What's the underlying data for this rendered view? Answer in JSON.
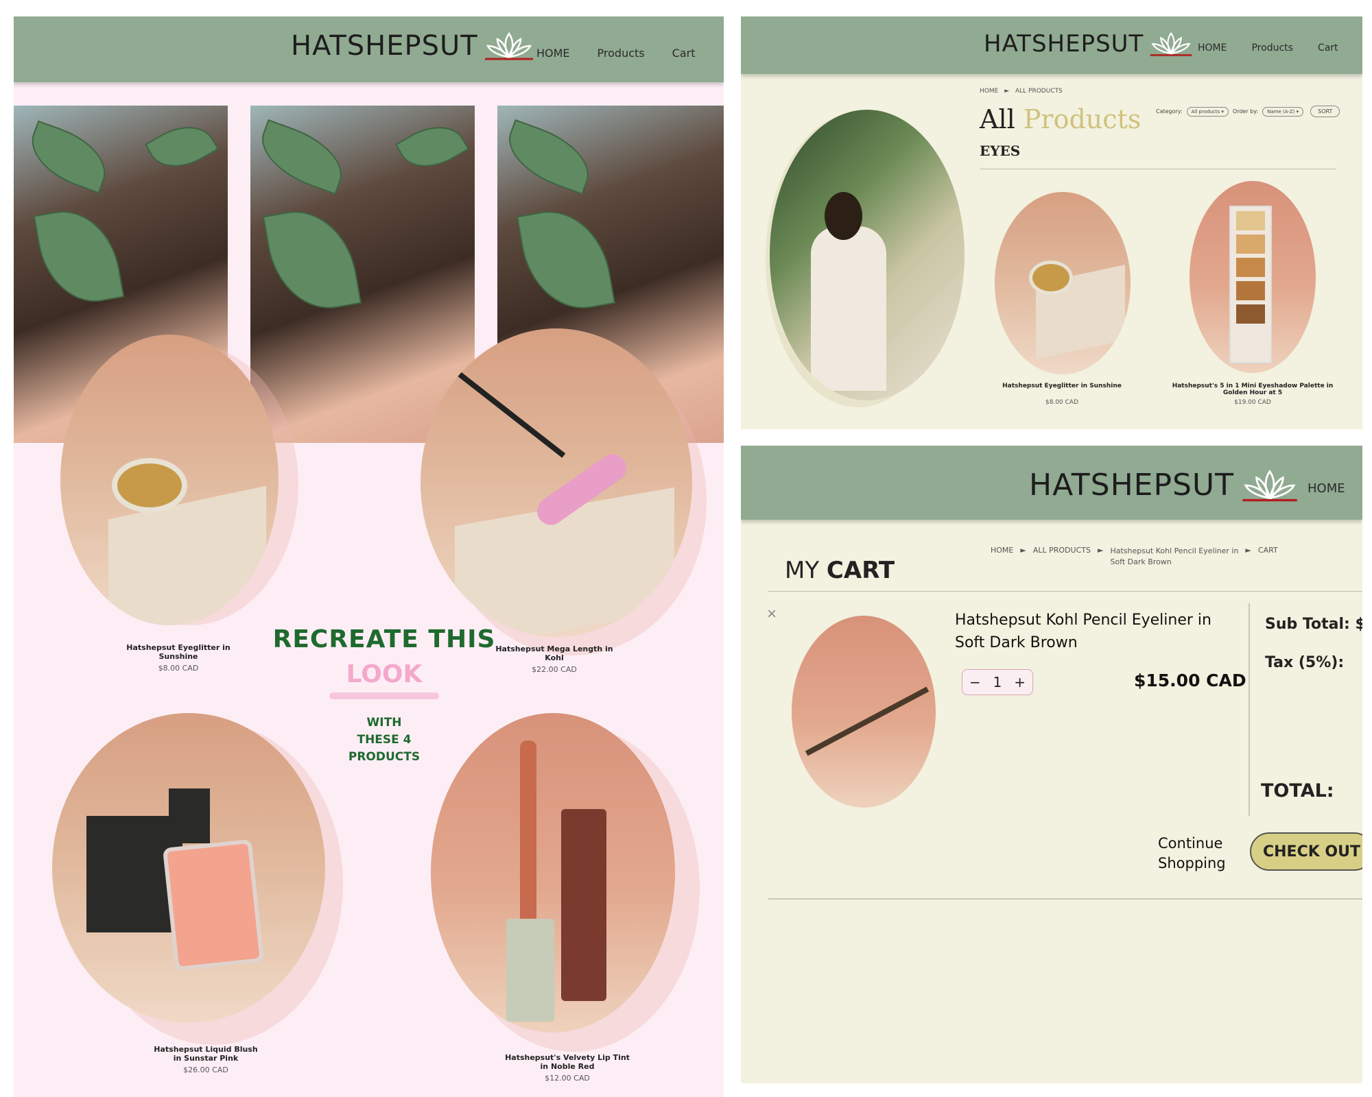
{
  "brand": {
    "name": "HATSHEPSUT"
  },
  "colors": {
    "header": "#91aa92",
    "pink_bg": "#fdeef5",
    "cream_bg": "#f3f1df",
    "accent_green": "#1f6a2e",
    "accent_pink": "#f4a8cc",
    "gold_button": "#d8cf86"
  },
  "landing": {
    "nav": [
      "HOME",
      "Products",
      "Cart"
    ],
    "headline_line1": "RECREATE THIS",
    "headline_line2": "LOOK",
    "subline": [
      "WITH",
      "THESE 4",
      "PRODUCTS"
    ],
    "products": [
      {
        "name": "Hatshepsut Eyeglitter in Sunshine",
        "price": "$8.00 CAD"
      },
      {
        "name": "Hatshepsut Mega Length in Kohl",
        "price": "$22.00 CAD"
      },
      {
        "name_line1": "Hatshepsut Liquid Blush",
        "name_line2": "in Sunstar Pink",
        "price": "$26.00 CAD"
      },
      {
        "name_line1": "Hatshepsut's Velvety Lip Tint",
        "name_line2": "in Noble Red",
        "price": "$12.00 CAD"
      }
    ]
  },
  "catalog": {
    "nav": [
      "HOME",
      "Products",
      "Cart"
    ],
    "breadcrumb": [
      "HOME",
      "ALL PRODUCTS"
    ],
    "title_part1": "All",
    "title_part2": "Products",
    "section": "EYES",
    "filters": {
      "category_label": "Category:",
      "category_value": "All products",
      "order_label": "Order by:",
      "order_value": "Name (A-Z)",
      "sort_button": "SORT"
    },
    "products": [
      {
        "name": "Hatshepsut Eyeglitter in Sunshine",
        "price": "$8.00 CAD"
      },
      {
        "name_line1": "Hatshepsut's 5 in 1 Mini Eyeshadow Palette in",
        "name_line2": "Golden Hour at 5",
        "price": "$19.00 CAD"
      }
    ]
  },
  "cart": {
    "nav": [
      "HOME"
    ],
    "breadcrumb": [
      "HOME",
      "ALL PRODUCTS",
      "Hatshepsut Kohl Pencil Eyeliner in",
      "Soft Dark Brown",
      "CART"
    ],
    "title_part1": "MY",
    "title_part2": "CART",
    "item": {
      "name_line1": "Hatshepsut Kohl Pencil Eyeliner in",
      "name_line2": "Soft Dark Brown",
      "quantity": "1",
      "price": "$15.00 CAD"
    },
    "summary": {
      "subtotal_label": "Sub Total: $",
      "tax_label": "Tax (5%):",
      "total_label": "TOTAL:"
    },
    "continue_line1": "Continue",
    "continue_line2": "Shopping",
    "checkout": "CHECK OUT"
  }
}
